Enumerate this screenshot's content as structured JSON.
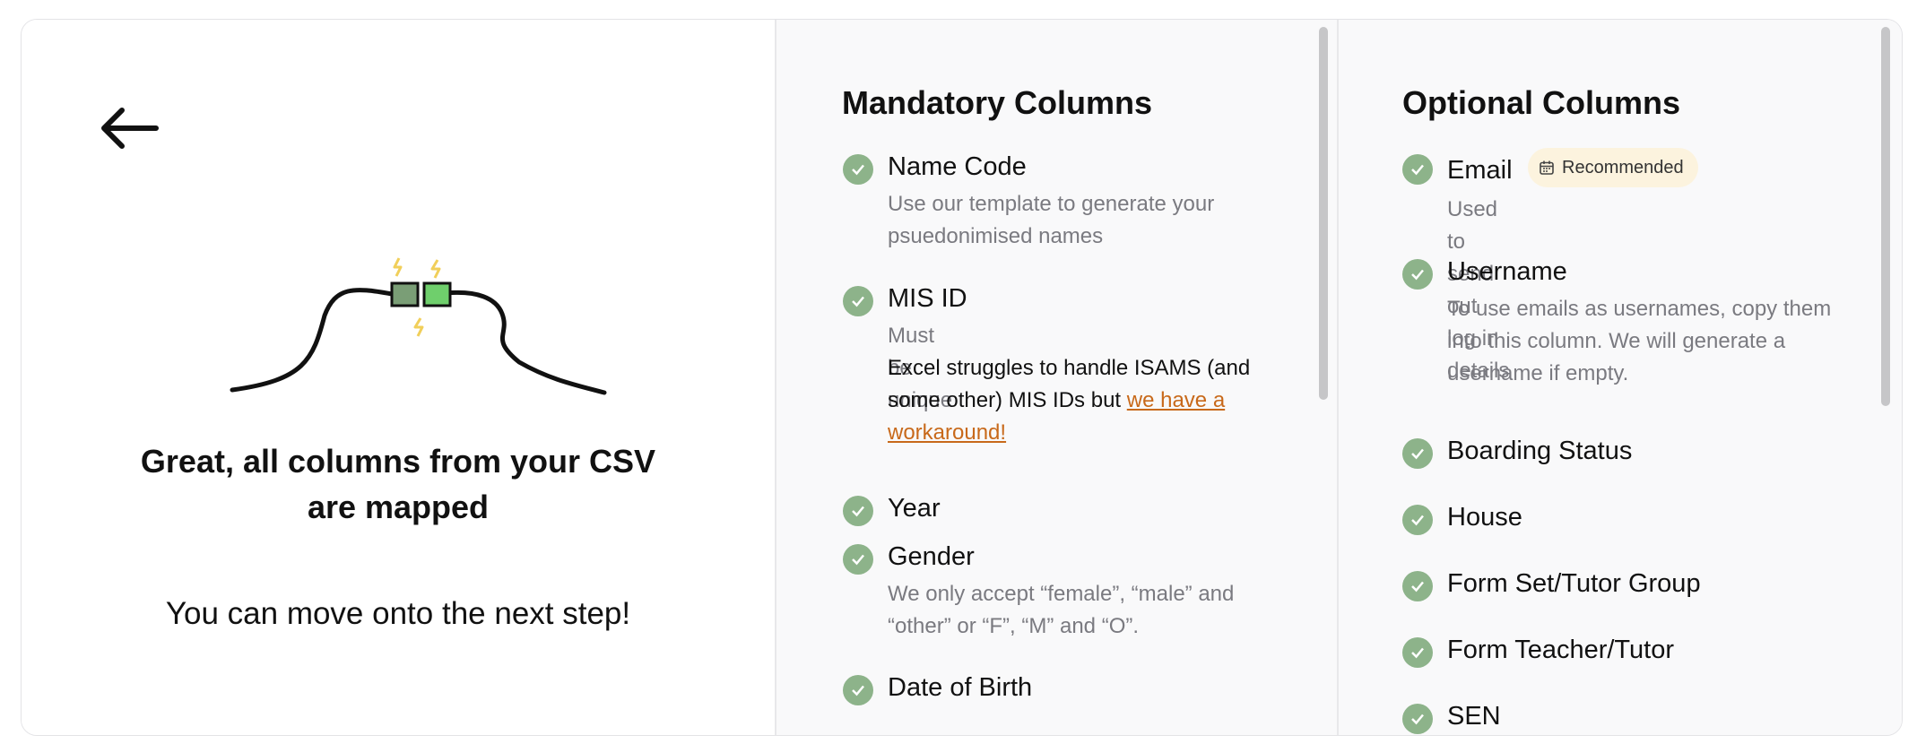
{
  "success": {
    "title": "Great, all columns from your CSV are mapped",
    "subtitle": "You can move onto the next step!"
  },
  "mandatory": {
    "title": "Mandatory Columns",
    "items": [
      {
        "name": "Name Code",
        "desc": "Use our template to generate your psuedonimised names"
      },
      {
        "name": "MIS ID",
        "desc": "Must be unique",
        "note_prefix": "Excel struggles to handle ISAMS (and some other) MIS IDs but ",
        "note_link": "we have a workaround!"
      },
      {
        "name": "Year"
      },
      {
        "name": "Gender",
        "desc": "We only accept “female”, “male” and “other” or “F”, “M” and “O”."
      },
      {
        "name": "Date of Birth"
      }
    ]
  },
  "optional": {
    "title": "Optional Columns",
    "items": [
      {
        "name": "Email",
        "badge": "Recommended",
        "desc": "Used to send out log in details"
      },
      {
        "name": "Username",
        "desc": "To use emails as usernames, copy them into this column. We will generate a username if empty."
      },
      {
        "name": "Boarding Status"
      },
      {
        "name": "House"
      },
      {
        "name": "Form Set/Tutor Group"
      },
      {
        "name": "Form Teacher/Tutor"
      },
      {
        "name": "SEN"
      }
    ]
  },
  "colors": {
    "check": "#8db38a",
    "link": "#c8691a",
    "badge_bg": "#fcf3de",
    "connector_dark": "#7a9e76",
    "connector_light": "#6fcf6c",
    "spark": "#f1cf5a"
  },
  "icons": {
    "back": "arrow-left-icon",
    "check": "check-circle-icon",
    "badge": "calendar-icon"
  },
  "scrollbars": {
    "mandatory_visible_fraction": 0.53,
    "optional_visible_fraction": 0.54
  }
}
